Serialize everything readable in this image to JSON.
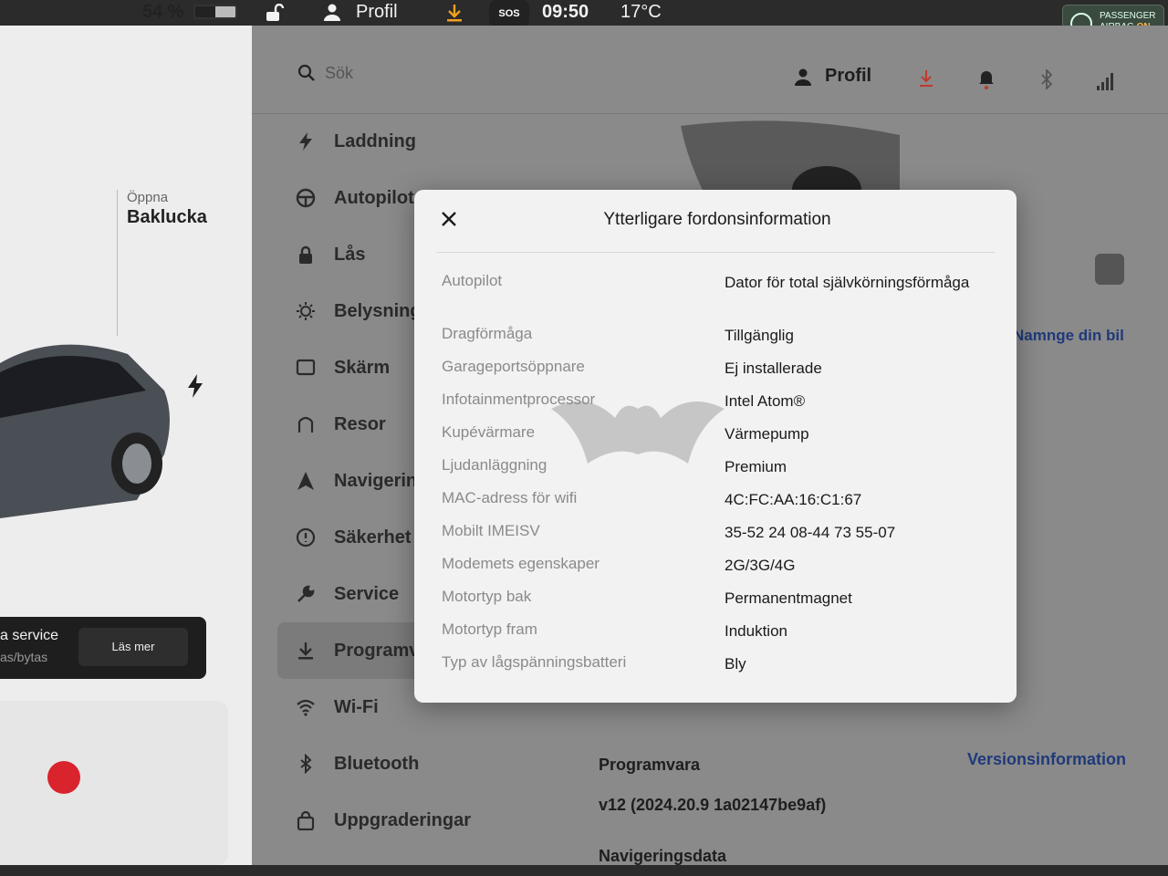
{
  "status_bar": {
    "battery": "54 %",
    "profile": "Profil",
    "sos": "SOS",
    "time": "09:50",
    "temperature": "17°C",
    "airbag_title": "PASSENGER",
    "airbag_label": "AIRBAG",
    "airbag_state": "ON"
  },
  "car_panel": {
    "open_label": "Öppna",
    "trunk_label": "Baklucka",
    "service_title": "a service",
    "service_sub": "as/bytas",
    "read_more": "Läs mer"
  },
  "search": {
    "placeholder": "Sök"
  },
  "header": {
    "profile": "Profil"
  },
  "nav": {
    "items": [
      {
        "label": "Laddning",
        "icon": "bolt-icon"
      },
      {
        "label": "Autopilot",
        "icon": "steering-wheel-icon"
      },
      {
        "label": "Lås",
        "icon": "lock-icon"
      },
      {
        "label": "Belysning",
        "icon": "light-icon"
      },
      {
        "label": "Skärm",
        "icon": "display-icon"
      },
      {
        "label": "Resor",
        "icon": "trips-icon"
      },
      {
        "label": "Navigering",
        "icon": "navigation-icon"
      },
      {
        "label": "Säkerhet",
        "icon": "safety-icon"
      },
      {
        "label": "Service",
        "icon": "wrench-icon"
      },
      {
        "label": "Programvara",
        "icon": "download-icon"
      },
      {
        "label": "Wi-Fi",
        "icon": "wifi-icon"
      },
      {
        "label": "Bluetooth",
        "icon": "bluetooth-icon"
      },
      {
        "label": "Uppgraderingar",
        "icon": "upgrade-bag-icon"
      }
    ]
  },
  "main": {
    "name_car": "Namnge din bil",
    "software_label": "Programvara",
    "version_info": "Versionsinformation",
    "version_value": "v12 (2024.20.9 1a02147be9af)",
    "nav_data": "Navigeringsdata"
  },
  "modal": {
    "title": "Ytterligare fordonsinformation",
    "rows": [
      {
        "label": "Autopilot",
        "value": "Dator för total självkörningsförmåga"
      },
      {
        "label": "Dragförmåga",
        "value": "Tillgänglig"
      },
      {
        "label": "Garageportsöppnare",
        "value": "Ej installerade"
      },
      {
        "label": "Infotainmentprocessor",
        "value": "Intel Atom®"
      },
      {
        "label": "Kupévärmare",
        "value": "Värmepump"
      },
      {
        "label": "Ljudanläggning",
        "value": "Premium"
      },
      {
        "label": "MAC-adress för wifi",
        "value": "4C:FC:AA:16:C1:67"
      },
      {
        "label": "Mobilt IMEISV",
        "value": "35-52 24 08-44 73 55-07"
      },
      {
        "label": "Modemets egenskaper",
        "value": "2G/3G/4G"
      },
      {
        "label": "Motortyp bak",
        "value": "Permanentmagnet"
      },
      {
        "label": "Motortyp fram",
        "value": "Induktion"
      },
      {
        "label": "Typ av lågspänningsbatteri",
        "value": "Bly"
      }
    ]
  },
  "colors": {
    "accent_link": "#1f3a7a",
    "airbag_on": "#ffb84d",
    "seatbelt_alert": "#d9232d"
  }
}
